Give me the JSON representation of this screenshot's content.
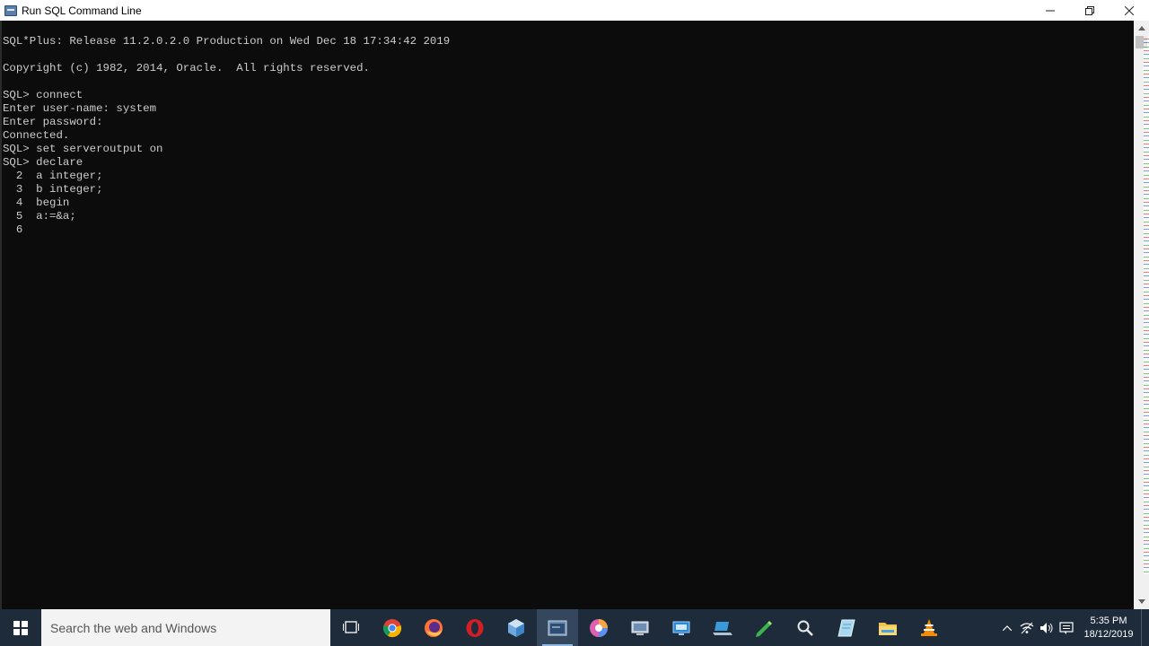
{
  "window": {
    "title": "Run SQL Command Line"
  },
  "console": {
    "text": "SQL*Plus: Release 11.2.0.2.0 Production on Wed Dec 18 17:34:42 2019\n\nCopyright (c) 1982, 2014, Oracle.  All rights reserved.\n\nSQL> connect\nEnter user-name: system\nEnter password:\nConnected.\nSQL> set serveroutput on\nSQL> declare\n  2  a integer;\n  3  b integer;\n  4  begin\n  5  a:=&a;\n  6"
  },
  "taskbar": {
    "search_placeholder": "Search the web and Windows",
    "apps": [
      {
        "icon": "task-view-icon"
      },
      {
        "icon": "chrome-icon"
      },
      {
        "icon": "firefox-icon"
      },
      {
        "icon": "opera-icon"
      },
      {
        "icon": "virtualbox-icon"
      },
      {
        "icon": "sql-command-line-icon",
        "active": true
      },
      {
        "icon": "swirl-app-icon"
      },
      {
        "icon": "pc-icon"
      },
      {
        "icon": "remote-desktop-icon"
      },
      {
        "icon": "laptop-icon"
      },
      {
        "icon": "pen-icon"
      },
      {
        "icon": "magnifier-icon"
      },
      {
        "icon": "notepad-icon"
      },
      {
        "icon": "file-explorer-icon"
      },
      {
        "icon": "vlc-icon"
      }
    ],
    "clock": {
      "time": "5:35 PM",
      "date": "18/12/2019"
    }
  },
  "colors": {
    "console_bg": "#0c0c0c",
    "console_text": "#cccccc",
    "taskbar_bg": "#1e2b3a",
    "title_bg": "#ffffff"
  }
}
